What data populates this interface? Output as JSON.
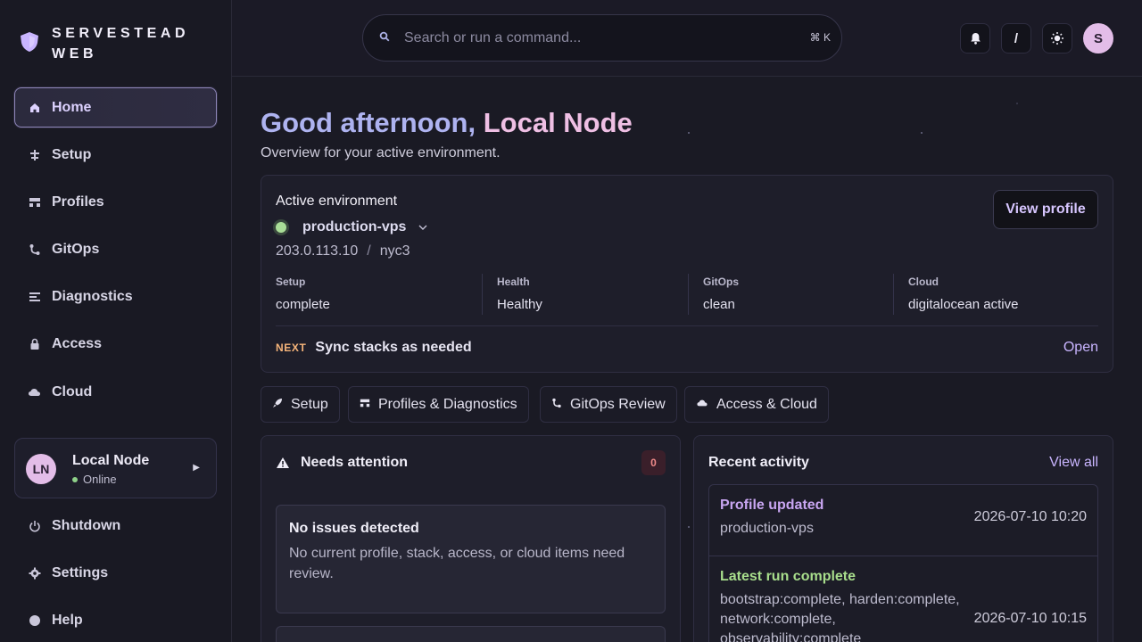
{
  "brand": {
    "line1": "SERVESTEAD",
    "line2": "WEB"
  },
  "nav": [
    {
      "label": "Home",
      "icon": "home-icon",
      "active": true
    },
    {
      "label": "Setup",
      "icon": "sliders-icon"
    },
    {
      "label": "Profiles",
      "icon": "profiles-icon"
    },
    {
      "label": "GitOps",
      "icon": "git-icon"
    },
    {
      "label": "Diagnostics",
      "icon": "diagnostics-icon"
    },
    {
      "label": "Access",
      "icon": "lock-icon"
    },
    {
      "label": "Cloud",
      "icon": "cloud-icon"
    }
  ],
  "node": {
    "initials": "LN",
    "name": "Local Node",
    "status": "Online"
  },
  "bottom_nav": [
    {
      "label": "Shutdown",
      "icon": "power-icon"
    },
    {
      "label": "Settings",
      "icon": "gear-icon"
    },
    {
      "label": "Help",
      "icon": "help-icon"
    }
  ],
  "search": {
    "placeholder": "Search or run a command...",
    "shortcut": "⌘ K"
  },
  "topbar": {
    "avatar": "S",
    "slash_label": "/"
  },
  "greeting": {
    "prefix": "Good afternoon,",
    "name": "Local Node",
    "subtitle": "Overview for your active environment."
  },
  "environment": {
    "label": "Active environment",
    "name": "production-vps",
    "ip": "203.0.113.10",
    "separator": "/",
    "region": "nyc3",
    "view_profile": "View profile",
    "stats": [
      {
        "label": "Setup",
        "value": "complete"
      },
      {
        "label": "Health",
        "value": "Healthy"
      },
      {
        "label": "GitOps",
        "value": "clean"
      },
      {
        "label": "Cloud",
        "value": "digitalocean active"
      }
    ],
    "next_tag": "NEXT",
    "next_text": "Sync stacks as needed",
    "next_action": "Open"
  },
  "quick_actions": [
    {
      "label": "Setup",
      "icon": "rocket-icon"
    },
    {
      "label": "Profiles & Diagnostics",
      "icon": "profiles-icon"
    },
    {
      "label": "GitOps Review",
      "icon": "git-icon"
    },
    {
      "label": "Access & Cloud",
      "icon": "cloud-icon"
    }
  ],
  "attention": {
    "title": "Needs attention",
    "count": "0",
    "empty_title": "No issues detected",
    "empty_text": "No current profile, stack, access, or cloud items need review."
  },
  "activity": {
    "title": "Recent activity",
    "view_all": "View all",
    "items": [
      {
        "title": "Profile updated",
        "detail": "production-vps",
        "time": "2026-07-10 10:20"
      },
      {
        "title": "Latest run complete",
        "detail": "bootstrap:complete, harden:complete, network:complete, observability:complete",
        "time": "2026-07-10 10:15"
      }
    ]
  },
  "colors": {
    "accent": "#c9b5ff",
    "greeting_blue": "#aeb3f0",
    "greeting_pink": "#efbfe4",
    "success": "#a8de8c",
    "warning": "#f5b47a"
  }
}
